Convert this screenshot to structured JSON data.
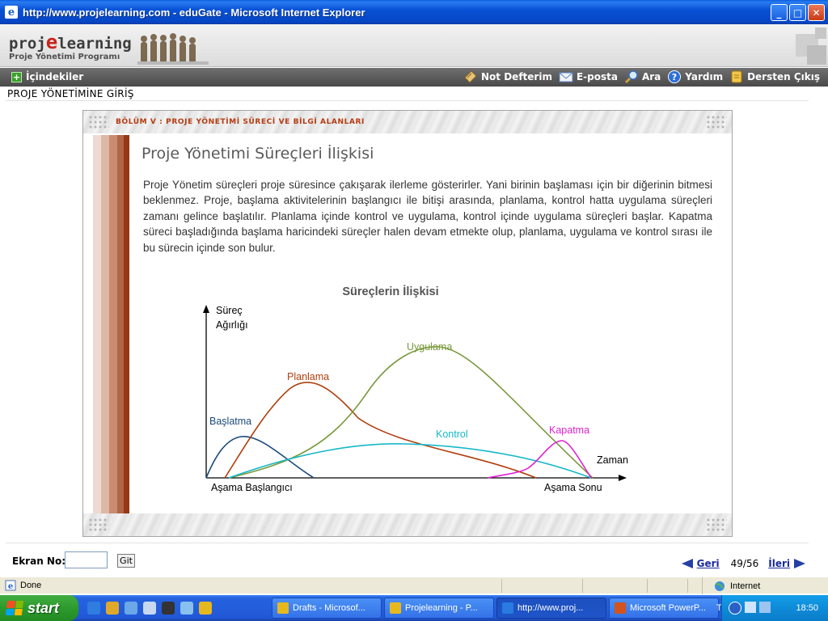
{
  "window": {
    "title": "http://www.projelearning.com - eduGate - Microsoft Internet Explorer",
    "minimize_glyph": "_",
    "maximize_glyph": "□",
    "close_glyph": "✕"
  },
  "site": {
    "logo_prefix": "proj",
    "logo_e": "e",
    "logo_suffix": "learning",
    "logo_subtitle": "Proje Yönetimi Programı"
  },
  "nav": {
    "toc_label": "İçindekiler",
    "items": [
      {
        "label": "Not Defterim",
        "icon": "notebook-icon"
      },
      {
        "label": "E-posta",
        "icon": "email-icon"
      },
      {
        "label": "Ara",
        "icon": "search-icon"
      },
      {
        "label": "Yardım",
        "icon": "help-icon"
      },
      {
        "label": "Dersten Çıkış",
        "icon": "exit-icon"
      }
    ]
  },
  "page": {
    "heading": "PROJE YÖNETİMİNE GİRİŞ",
    "section_title": "BÖLÜM V : PROJE YÖNETİMİ SÜRECİ VE BİLGİ ALANLARI",
    "lesson_title": "Proje Yönetimi Süreçleri İlişkisi",
    "lesson_body": "Proje Yönetim süreçleri proje süresince çakışarak ilerleme gösterirler. Yani birinin başlaması için bir diğerinin bitmesi beklenmez. Proje, başlama aktivitelerinin başlangıcı ile bitişi arasında, planlama, kontrol hatta uygulama süreçleri zamanı gelince başlatılır. Planlama içinde kontrol ve uygulama, kontrol içinde uygulama süreçleri başlar. Kapatma süreci başladığında başlama haricindeki süreçler halen devam etmekte olup, planlama, uygulama ve kontrol sırası ile bu sürecin içinde son bulur.",
    "stripe_colors": [
      "#eedad2",
      "#dcb7a6",
      "#c98c72",
      "#b26446",
      "#963818"
    ]
  },
  "chart": {
    "title": "Süreçlerin İlişkisi",
    "y_label_line1": "Süreç",
    "y_label_line2": "Ağırlığı",
    "x_label": "Zaman",
    "x_start": "Aşama Başlangıcı",
    "x_end": "Aşama Sonu",
    "series": [
      {
        "name": "Başlatma",
        "color": "#1c4a7a"
      },
      {
        "name": "Planlama",
        "color": "#b0400e"
      },
      {
        "name": "Uygulama",
        "color": "#7a9a3c"
      },
      {
        "name": "Kontrol",
        "color": "#16b8c8"
      },
      {
        "name": "Kapatma",
        "color": "#e020d0"
      }
    ]
  },
  "footer": {
    "screen_label": "Ekran No:",
    "screen_input_value": "",
    "go_button": "Git",
    "prev_label": "Geri",
    "page_indicator": "49/56",
    "next_label": "İleri"
  },
  "status": {
    "text": "Done",
    "zone": "Internet"
  },
  "taskbar": {
    "start_label": "start",
    "tasks": [
      {
        "label": "Drafts - Microsof...",
        "active": false,
        "icon_color": "#e6b820"
      },
      {
        "label": "Projelearning - P...",
        "active": false,
        "icon_color": "#e6b820"
      },
      {
        "label": "http://www.proj...",
        "active": true,
        "icon_color": "#2a7ae0"
      },
      {
        "label": "Microsoft PowerP...",
        "active": false,
        "icon_color": "#d2541c"
      }
    ],
    "language": "TR",
    "clock": "18:50"
  }
}
